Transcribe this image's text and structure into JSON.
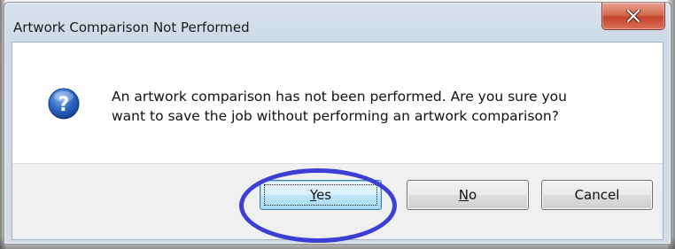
{
  "window": {
    "title": "Artwork Comparison Not Performed",
    "close_icon": "close-x-icon"
  },
  "message": {
    "icon": "question-icon",
    "line1": "An artwork comparison has not been performed.  Are you sure you",
    "line2": "want to save the job without performing an artwork comparison?"
  },
  "buttons": {
    "yes": {
      "label": "Yes",
      "mnemonic": "Y",
      "rest": "es",
      "default": true
    },
    "no": {
      "label": "No",
      "mnemonic": "N",
      "rest": "o"
    },
    "cancel": {
      "label": "Cancel"
    }
  },
  "annotation": {
    "highlight_color": "#3b3fd6",
    "target": "Yes"
  },
  "colors": {
    "accent": "#3b3fd6",
    "close_button": "#c4432a",
    "default_button_border": "#3c7fb1"
  }
}
